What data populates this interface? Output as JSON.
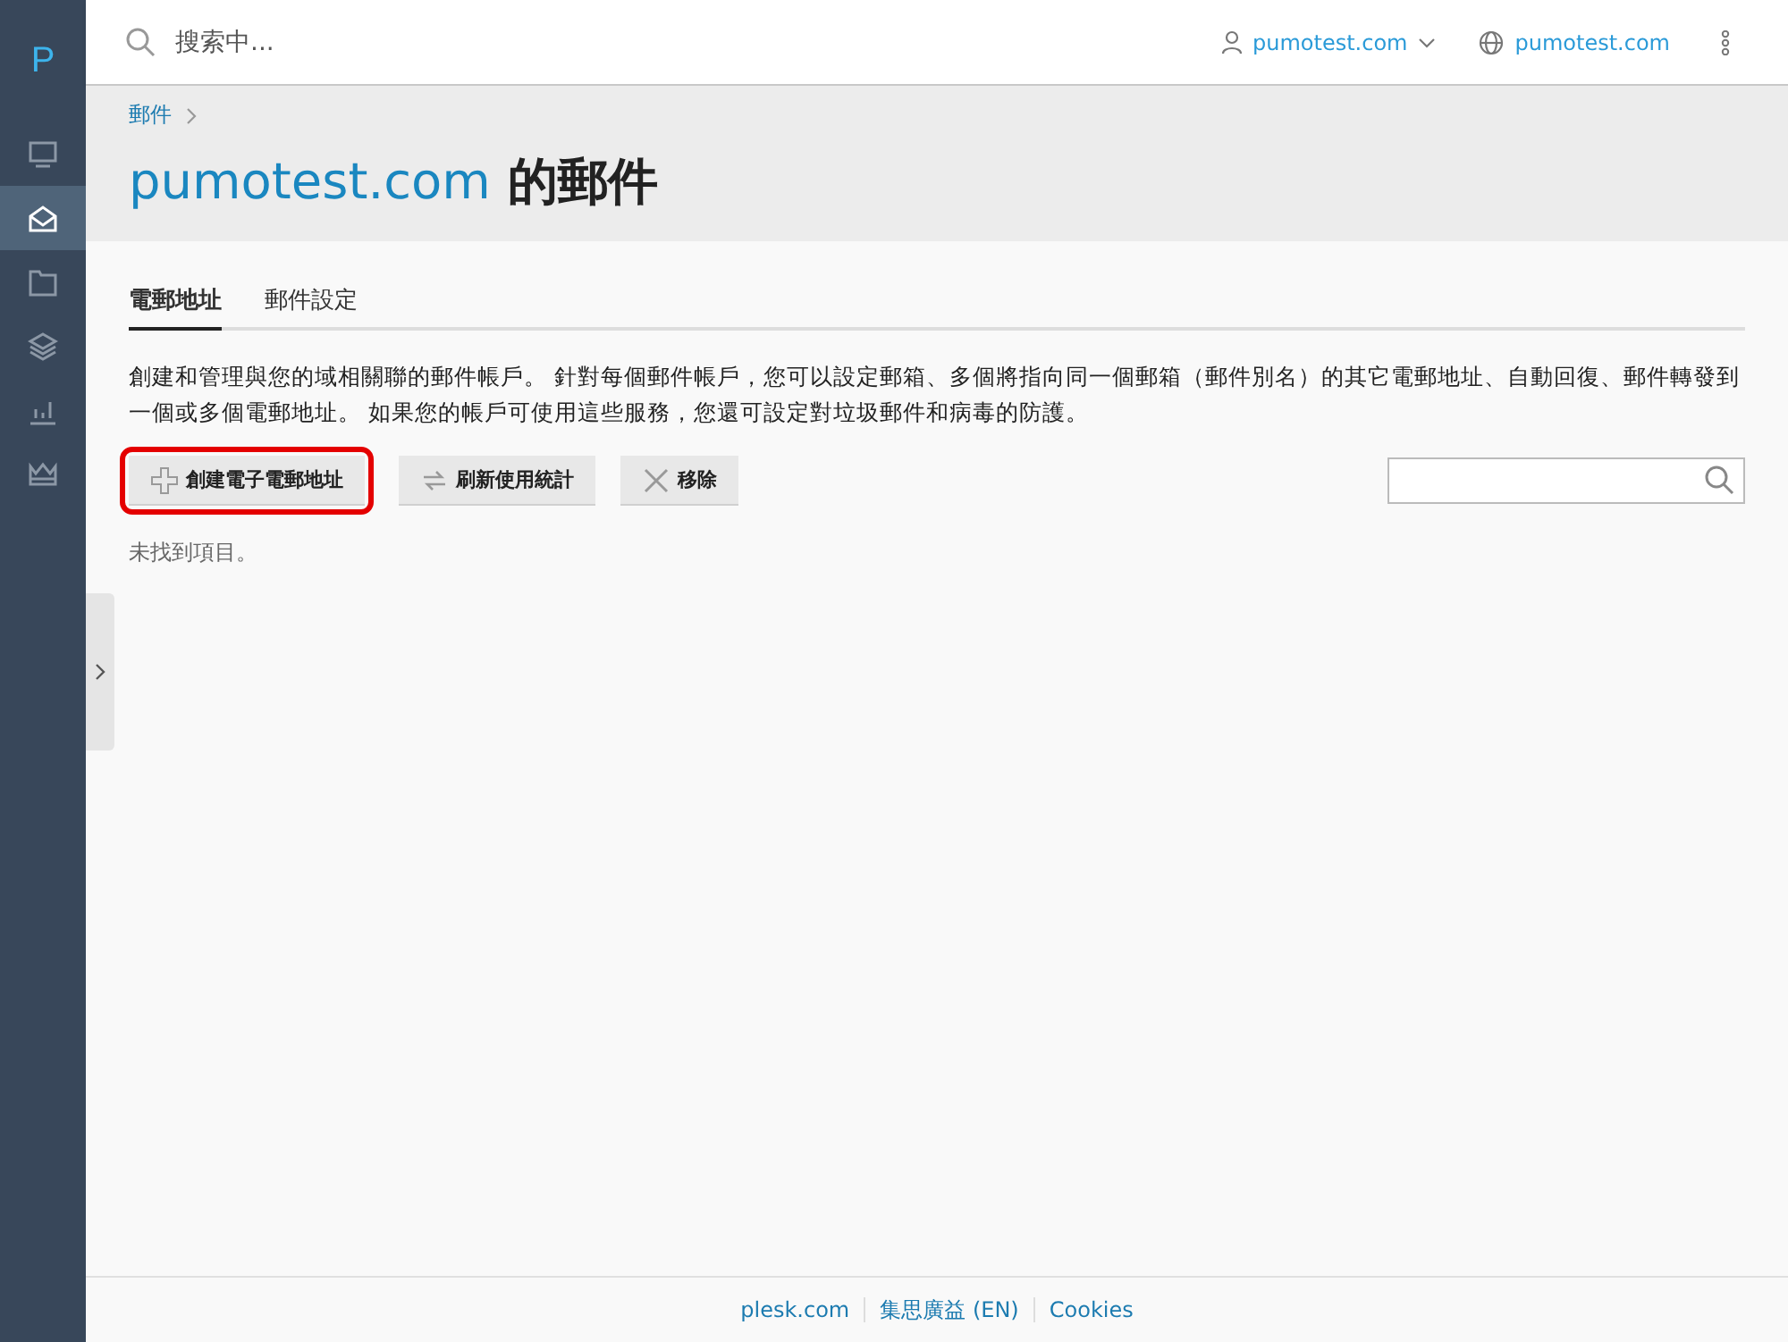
{
  "sidebar": {
    "logo": "P",
    "items": [
      {
        "selected": false
      },
      {
        "selected": true
      },
      {
        "selected": false
      },
      {
        "selected": false
      },
      {
        "selected": false
      },
      {
        "selected": false
      }
    ]
  },
  "topbar": {
    "search": {
      "placeholder": "搜索中..."
    },
    "account": "pumotest.com",
    "site": "pumotest.com"
  },
  "breadcrumb": [
    "郵件"
  ],
  "title": {
    "domain": "pumotest.com",
    "suffix": "的郵件"
  },
  "tabs": [
    {
      "label": "電郵地址",
      "selected": true
    },
    {
      "label": "郵件設定",
      "selected": false
    }
  ],
  "description": "創建和管理與您的域相關聯的郵件帳戶。 針對每個郵件帳戶，您可以設定郵箱、多個將指向同一個郵箱（郵件別名）的其它電郵地址、自動回復、郵件轉發到一個或多個電郵地址。 如果您的帳戶可使用這些服務，您還可設定對垃圾郵件和病毒的防護。",
  "toolbar": [
    {
      "label": "創建電子電郵地址",
      "highlighted": true
    },
    {
      "label": "刷新使用統計",
      "highlighted": false
    },
    {
      "label": "移除",
      "highlighted": false
    }
  ],
  "empty_message": "未找到項目。",
  "footer": [
    "plesk.com",
    "集思廣益 (EN)",
    "Cookies"
  ]
}
